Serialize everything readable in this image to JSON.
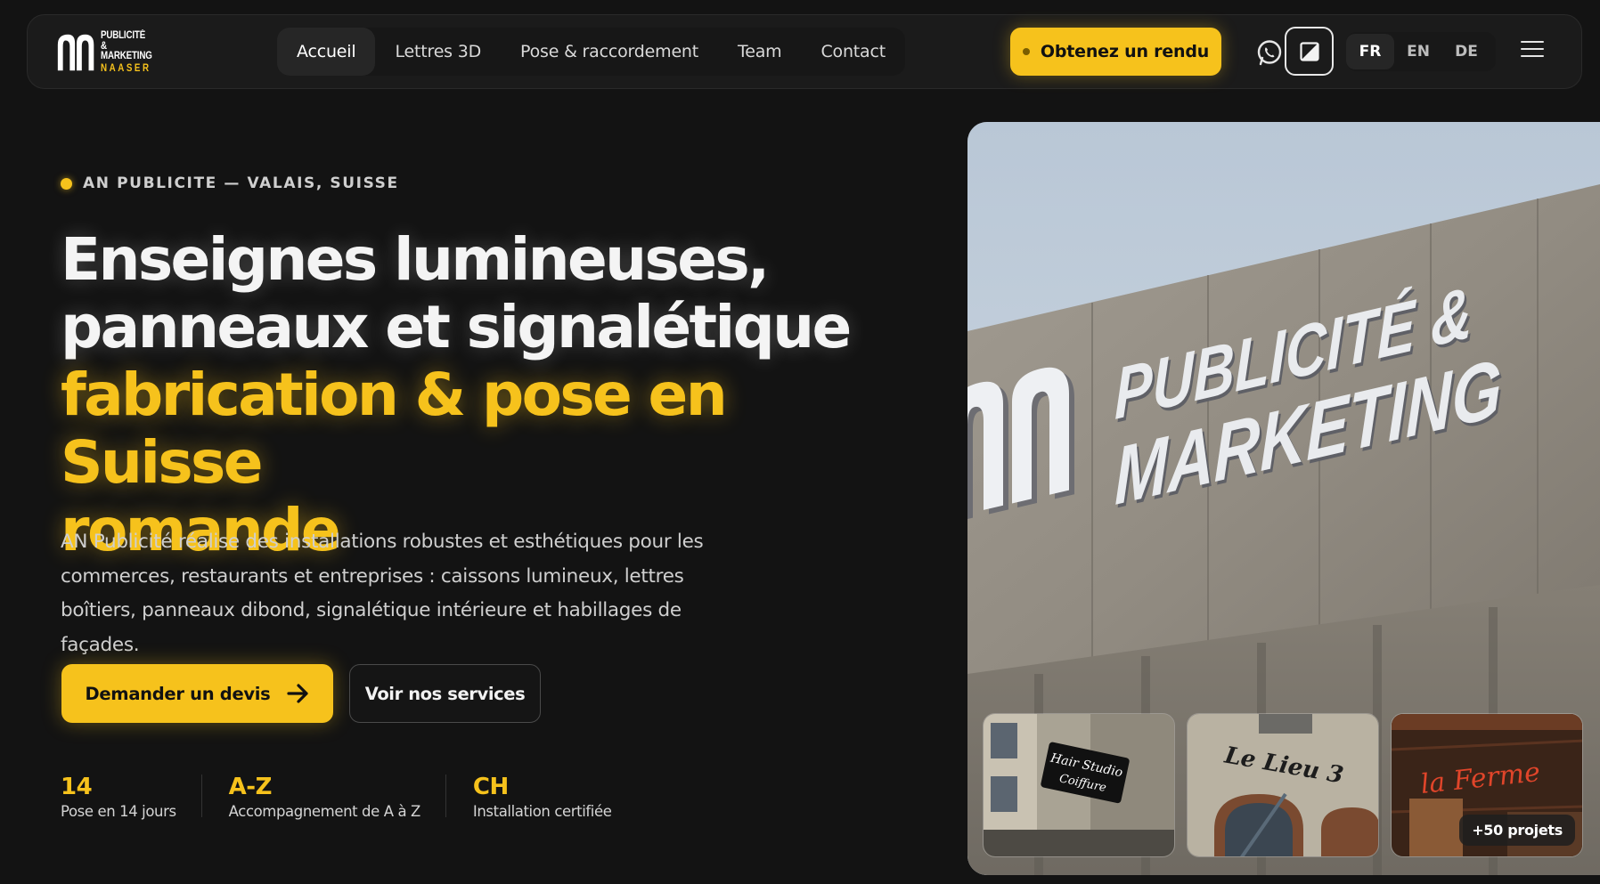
{
  "brand": {
    "logo_line1": "PUBLICITÉ &",
    "logo_line2": "MARKETING",
    "logo_line3": "NAASER",
    "accent_color": "#f6c21c"
  },
  "nav": {
    "items": [
      {
        "label": "Accueil",
        "active": true
      },
      {
        "label": "Lettres 3D"
      },
      {
        "label": "Pose & raccordement"
      },
      {
        "label": "Team"
      },
      {
        "label": "Contact"
      }
    ]
  },
  "header": {
    "cta_label": "Obtenez un rendu",
    "whatsapp_icon": "whatsapp-icon",
    "theme_icon": "contrast-icon",
    "languages": [
      {
        "label": "FR",
        "active": true
      },
      {
        "label": "EN"
      },
      {
        "label": "DE"
      }
    ],
    "menu_icon": "hamburger-icon"
  },
  "hero": {
    "eyebrow": "AN PUBLICITE — VALAIS, SUISSE",
    "headline_line1": "Enseignes lumineuses,",
    "headline_line2": "panneaux et signalétique",
    "headline_line3": "fabrication & pose en Suisse",
    "headline_line4": "romande",
    "lead": "AN Publicité réalise des installations robustes et esthétiques pour les commerces, restaurants et entreprises : caissons lumineux, lettres boîtiers, panneaux dibond, signalétique intérieure et habillages de façades.",
    "primary_button": "Demander un devis",
    "secondary_button": "Voir nos services",
    "stats": [
      {
        "value": "14",
        "label": "Pose en 14 jours"
      },
      {
        "value": "A-Z",
        "label": "Accompagnement de A à Z"
      },
      {
        "value": "CH",
        "label": "Installation certifiée"
      }
    ]
  },
  "gallery": {
    "main_sign_line1": "PUBLICITÉ &",
    "main_sign_line2": "MARKETING",
    "thumbs": [
      {
        "sign_line1": "Hair Studio",
        "sign_line2": "Coiffure"
      },
      {
        "sign_line1": "Le Lieu 3"
      },
      {
        "sign_line1": "la Ferme"
      }
    ],
    "projects_badge": "+50 projets"
  }
}
